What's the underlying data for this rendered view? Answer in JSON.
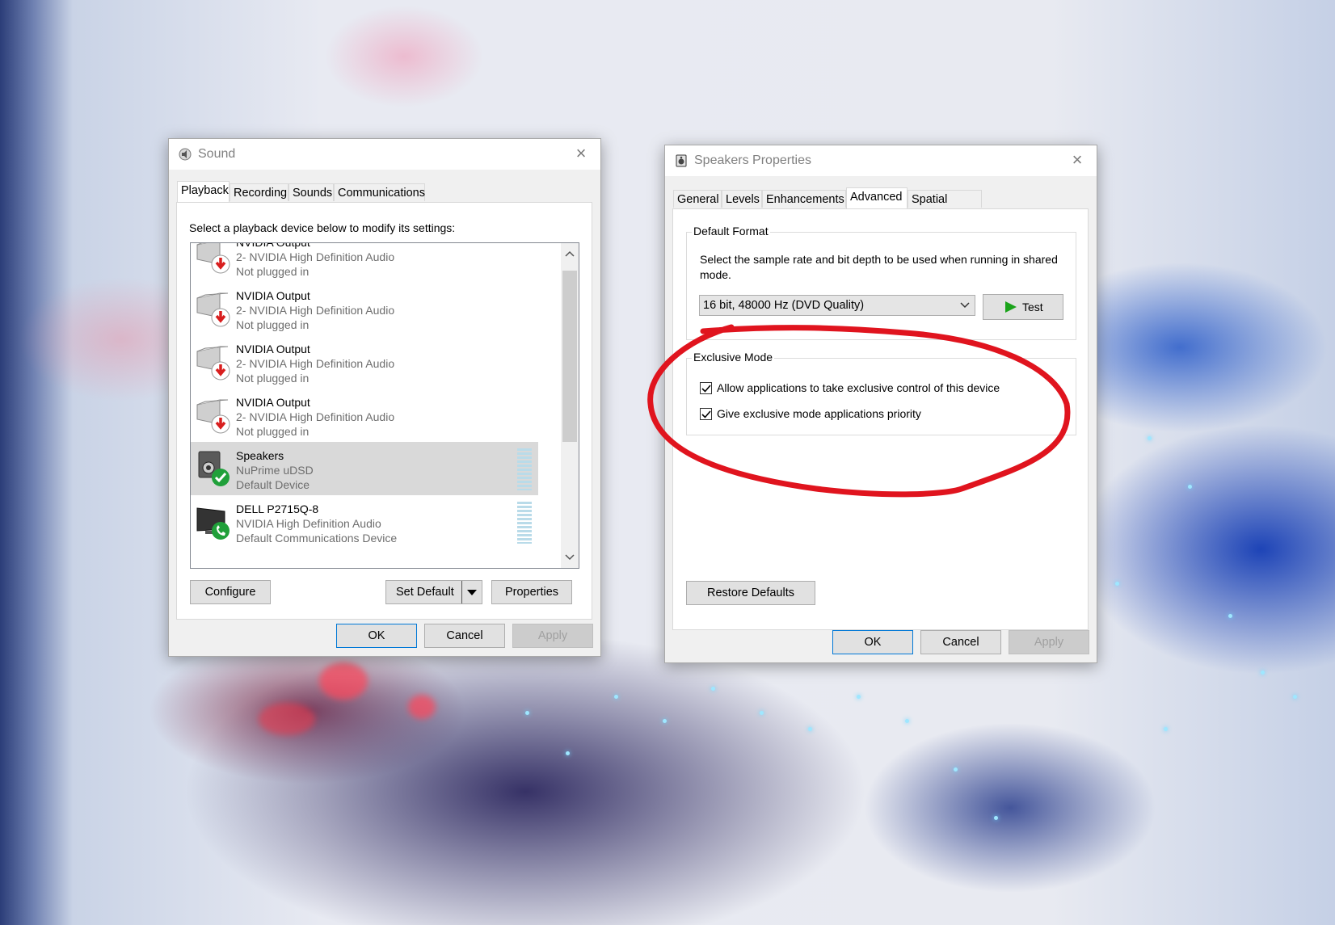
{
  "sound_window": {
    "title": "Sound",
    "close_glyph": "×",
    "tabs": [
      "Playback",
      "Recording",
      "Sounds",
      "Communications"
    ],
    "active_tab": "Playback",
    "instruction": "Select a playback device below to modify its settings:",
    "devices": [
      {
        "name": "NVIDIA Output",
        "desc": "2- NVIDIA High Definition Audio",
        "status": "Not plugged in",
        "icon": "speaker-unplugged-icon",
        "selected": false
      },
      {
        "name": "NVIDIA Output",
        "desc": "2- NVIDIA High Definition Audio",
        "status": "Not plugged in",
        "icon": "speaker-unplugged-icon",
        "selected": false
      },
      {
        "name": "NVIDIA Output",
        "desc": "2- NVIDIA High Definition Audio",
        "status": "Not plugged in",
        "icon": "speaker-unplugged-icon",
        "selected": false
      },
      {
        "name": "NVIDIA Output",
        "desc": "2- NVIDIA High Definition Audio",
        "status": "Not plugged in",
        "icon": "speaker-unplugged-icon",
        "selected": false
      },
      {
        "name": "Speakers",
        "desc": "NuPrime uDSD",
        "status": "Default Device",
        "icon": "speaker-default-icon",
        "selected": true
      },
      {
        "name": "DELL P2715Q-8",
        "desc": "NVIDIA High Definition Audio",
        "status": "Default Communications Device",
        "icon": "monitor-communications-icon",
        "selected": false
      }
    ],
    "buttons": {
      "configure": "Configure",
      "set_default": "Set Default",
      "properties": "Properties",
      "ok": "OK",
      "cancel": "Cancel",
      "apply": "Apply"
    }
  },
  "props_window": {
    "title": "Speakers Properties",
    "close_glyph": "×",
    "tabs": [
      "General",
      "Levels",
      "Enhancements",
      "Advanced",
      "Spatial sound"
    ],
    "active_tab": "Advanced",
    "default_format": {
      "legend": "Default Format",
      "description": "Select the sample rate and bit depth to be used when running in shared mode.",
      "selected_format": "16 bit, 48000 Hz (DVD Quality)",
      "test_label": "Test"
    },
    "exclusive_mode": {
      "legend": "Exclusive Mode",
      "options": [
        {
          "label": "Allow applications to take exclusive control of this device",
          "checked": true
        },
        {
          "label": "Give exclusive mode applications priority",
          "checked": true
        }
      ]
    },
    "buttons": {
      "restore_defaults": "Restore Defaults",
      "ok": "OK",
      "cancel": "Cancel",
      "apply": "Apply"
    }
  },
  "annotation": {
    "color": "#e0141e",
    "shape": "hand-drawn-ellipse"
  },
  "colors": {
    "accent": "#0078d7",
    "play_green": "#1aa31a",
    "unplugged_red": "#d81e1e",
    "default_green": "#20a03a"
  }
}
